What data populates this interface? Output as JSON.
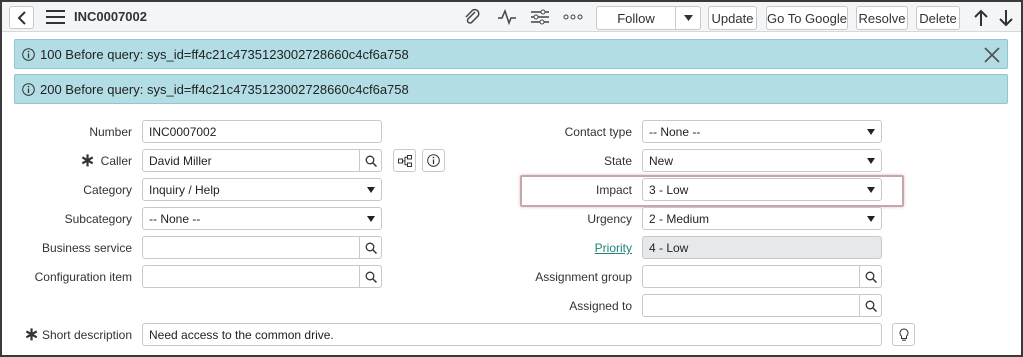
{
  "header": {
    "record_number": "INC0007002",
    "follow_label": "Follow",
    "buttons": {
      "update": "Update",
      "go_to_google": "Go To Google",
      "resolve": "Resolve",
      "delete": "Delete"
    },
    "icons": [
      "back-icon",
      "menu-icon",
      "attachment-icon",
      "activity-icon",
      "settings-icon",
      "more-icon",
      "arrow-up-icon",
      "arrow-down-icon"
    ]
  },
  "messages": [
    {
      "text": "100 Before query: sys_id=ff4c21c4735123002728660c4cf6a758",
      "closable": true
    },
    {
      "text": "200 Before query: sys_id=ff4c21c4735123002728660c4cf6a758",
      "closable": false
    }
  ],
  "form": {
    "left": {
      "number": {
        "label": "Number",
        "value": "INC0007002"
      },
      "caller": {
        "label": "Caller",
        "value": "David Miller",
        "mandatory": true
      },
      "category": {
        "label": "Category",
        "value": "Inquiry / Help"
      },
      "subcategory": {
        "label": "Subcategory",
        "value": "-- None --"
      },
      "business_service": {
        "label": "Business service",
        "value": ""
      },
      "configuration_item": {
        "label": "Configuration item",
        "value": ""
      }
    },
    "right": {
      "contact_type": {
        "label": "Contact type",
        "value": "-- None --"
      },
      "state": {
        "label": "State",
        "value": "New"
      },
      "impact": {
        "label": "Impact",
        "value": "3 - Low",
        "highlighted": true
      },
      "urgency": {
        "label": "Urgency",
        "value": "2 - Medium"
      },
      "priority": {
        "label": "Priority",
        "value": "4 - Low",
        "readonly": true
      },
      "assignment_group": {
        "label": "Assignment group",
        "value": ""
      },
      "assigned_to": {
        "label": "Assigned to",
        "value": ""
      }
    },
    "short_description": {
      "label": "Short description",
      "value": "Need access to the common drive.",
      "mandatory": true
    }
  },
  "colors": {
    "message_bg": "#b3dde4",
    "link": "#1f8476",
    "highlight_border": "#c9a4a8"
  }
}
